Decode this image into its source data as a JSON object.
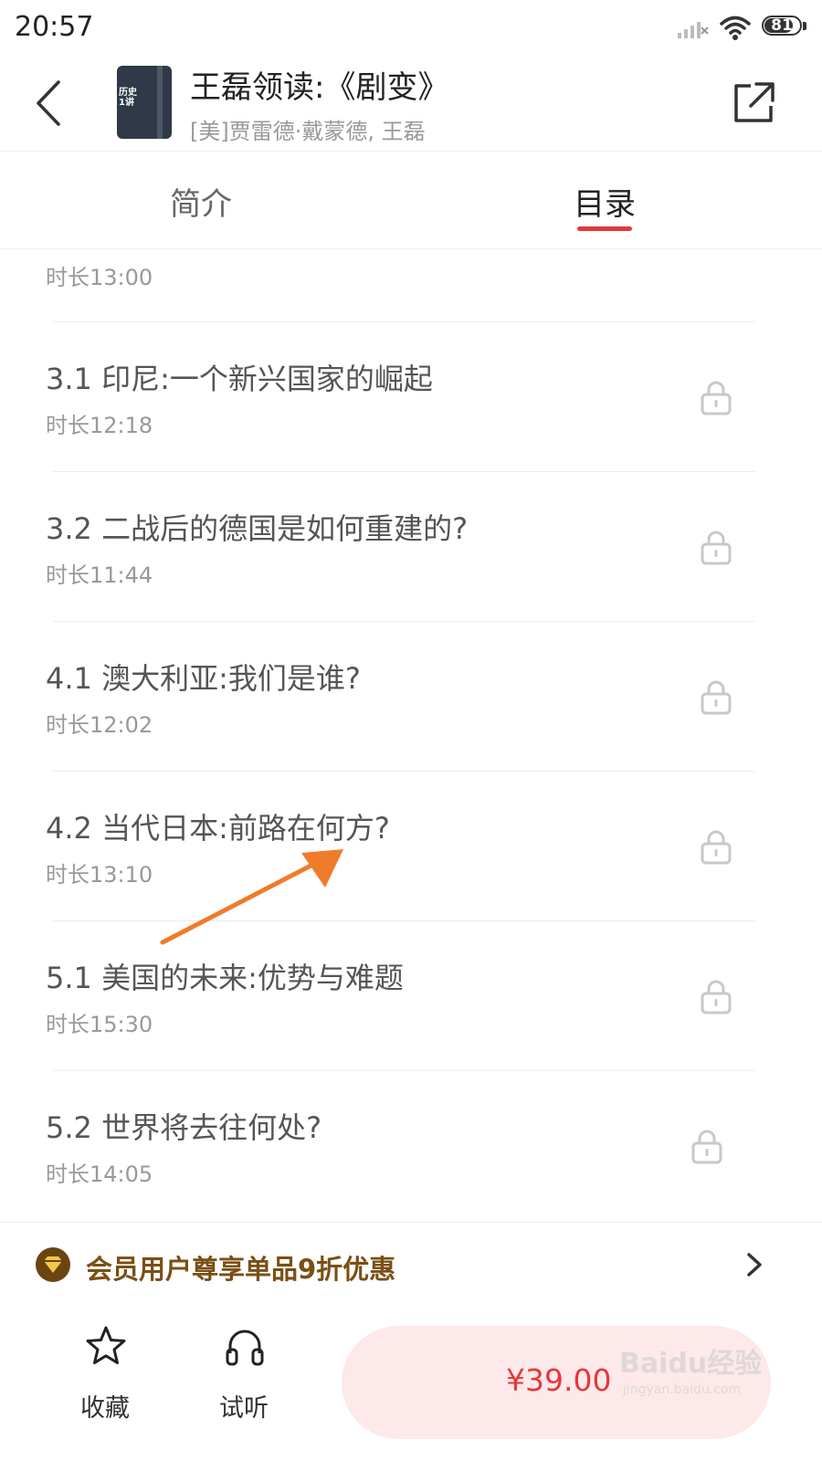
{
  "status_bar": {
    "time": "20:57",
    "battery": "81",
    "battery_level": 0.81
  },
  "header": {
    "cover_text": "历史\n1讲",
    "title": "王磊领读:《剧变》",
    "subtitle": "[美]贾雷德·戴蒙德, 王磊"
  },
  "tabs": [
    {
      "label": "简介",
      "active": false
    },
    {
      "label": "目录",
      "active": true
    }
  ],
  "list": {
    "partial_duration": "时长13:00",
    "items": [
      {
        "title": "3.1 印尼:一个新兴国家的崛起",
        "duration": "时长12:18",
        "locked": true
      },
      {
        "title": "3.2 二战后的德国是如何重建的?",
        "duration": "时长11:44",
        "locked": true
      },
      {
        "title": "4.1 澳大利亚:我们是谁?",
        "duration": "时长12:02",
        "locked": true
      },
      {
        "title": "4.2 当代日本:前路在何方?",
        "duration": "时长13:10",
        "locked": true
      },
      {
        "title": "5.1 美国的未来:优势与难题",
        "duration": "时长15:30",
        "locked": true
      },
      {
        "title": "5.2 世界将去往何处?",
        "duration": "时长14:05",
        "locked": true
      }
    ]
  },
  "promo": {
    "text": "会员用户尊享单品9折优惠"
  },
  "bottom_bar": {
    "favorite_label": "收藏",
    "listen_label": "试听",
    "price": "¥39.00"
  },
  "watermark": {
    "main": "Baidu经验",
    "sub": "jingyan.baidu.com"
  },
  "colors": {
    "accent": "#e5383b",
    "promo_text": "#7a4f14",
    "buy_bg": "#fde9e9",
    "annotation_arrow": "#f07b2a"
  }
}
